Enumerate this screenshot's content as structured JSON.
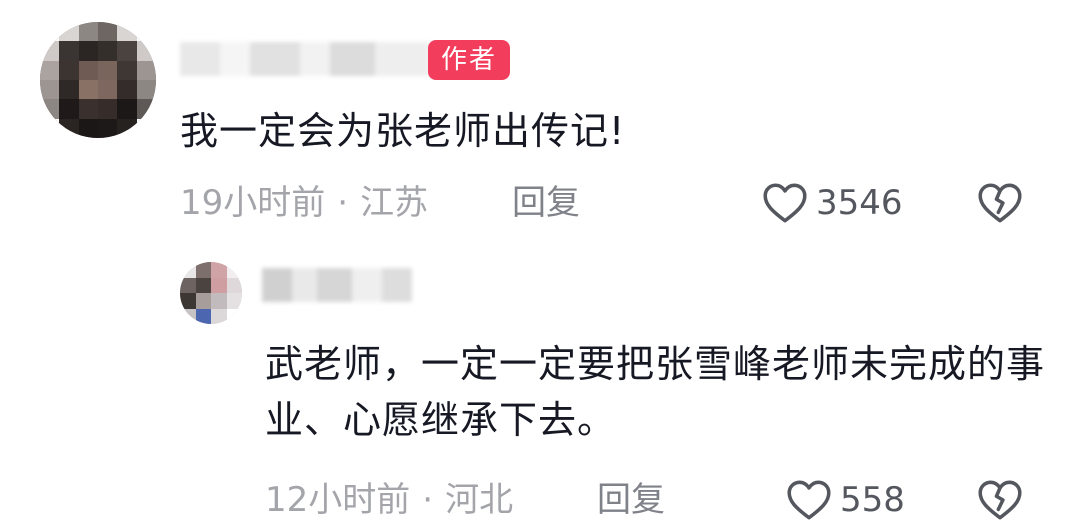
{
  "comments": [
    {
      "badge": "作者",
      "text": "我一定会为张老师出传记!",
      "time": "19小时前",
      "location": "江苏",
      "reply_label": "回复",
      "likes": "3546"
    }
  ],
  "replies": [
    {
      "text": "武老师，一定一定要把张雪峰老师未完成的事业、心愿继承下去。",
      "time": "12小时前",
      "location": "河北",
      "reply_label": "回复",
      "likes": "558"
    }
  ],
  "meta_separator": "·",
  "icons": {
    "like": "heart-outline-icon",
    "dislike": "broken-heart-icon"
  },
  "colors": {
    "badge_bg": "#f33d5c",
    "meta_text": "#a4a5aa",
    "body_text": "#161823"
  }
}
